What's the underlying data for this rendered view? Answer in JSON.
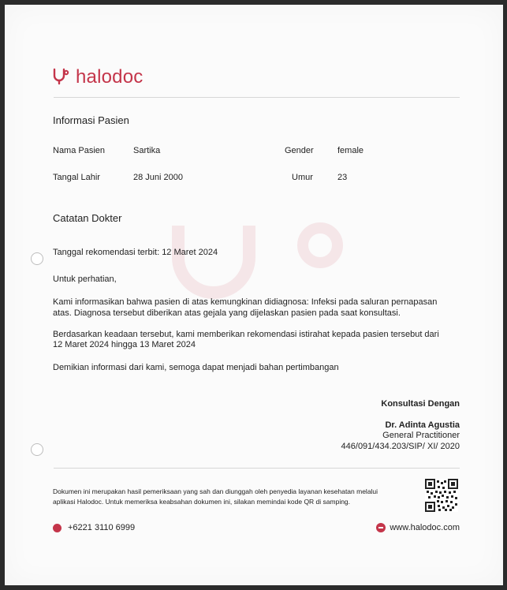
{
  "brand": {
    "name": "halodoc",
    "color": "#c4354a"
  },
  "patient_section": {
    "heading": "Informasi Pasien",
    "name_label": "Nama Pasien",
    "name_value": "Sartika",
    "gender_label": "Gender",
    "gender_value": "female",
    "dob_label": "Tangal Lahir",
    "dob_value": "28 Juni 2000",
    "age_label": "Umur",
    "age_value": "23"
  },
  "notes_section": {
    "heading": "Catatan Dokter",
    "issued_date": "Tanggal rekomendasi terbit: 12 Maret 2024",
    "attention": "Untuk perhatian,",
    "para1_line1": "Kami informasikan bahwa pasien di atas kemungkinan didiagnosa: Infeksi pada saluran pernapasan",
    "para1_line2": "atas. Diagnosa tersebut diberikan atas gejala yang dijelaskan pasien pada saat konsultasi.",
    "para2_line1": "Berdasarkan keadaan tersebut, kami memberikan rekomendasi istirahat kepada pasien tersebut dari",
    "para2_line2": "12 Maret 2024 hingga 13 Maret 2024",
    "closing": "Demikian informasi dari kami, semoga dapat menjadi bahan pertimbangan"
  },
  "signature": {
    "title": "Konsultasi Dengan",
    "doctor": "Dr. Adinta Agustia",
    "role": "General Practitioner",
    "license": "446/091/434.203/SIP/ XI/ 2020"
  },
  "footer": {
    "note_line1": "Dokumen ini merupakan hasil pemeriksaan yang sah dan diunggah oleh penyedia layanan kesehatan melalui",
    "note_line2": "aplikasi Halodoc. Untuk memeriksa keabsahan dokumen ini, silakan memindai kode QR di samping.",
    "phone": "+6221 3110 6999",
    "website": "www.halodoc.com",
    "qr_icon": "qr-code"
  }
}
